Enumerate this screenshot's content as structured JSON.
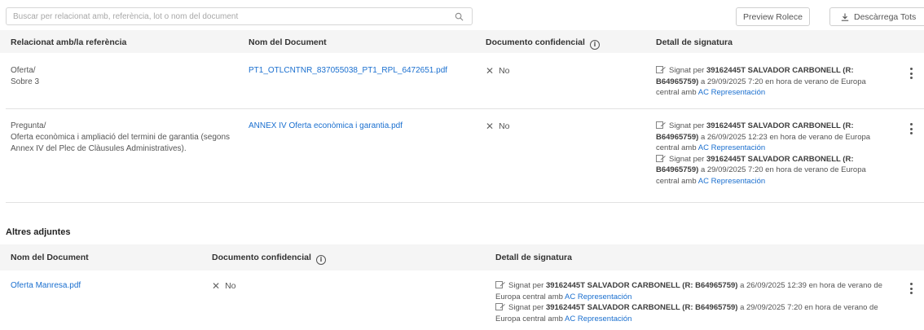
{
  "search": {
    "placeholder": "Buscar per relacionat amb, referència, lot o nom del document",
    "value": ""
  },
  "toolbar": {
    "preview_label": "Preview Rolece",
    "download_label": "Descàrrega Tots"
  },
  "table1": {
    "headers": {
      "related": "Relacionat amb/la referència",
      "doc_name": "Nom del Document",
      "confidential": "Documento confidencial",
      "signature": "Detall de signatura"
    },
    "rows": [
      {
        "related_line1": "Oferta/",
        "related_line2": "Sobre 3",
        "doc_name": "PT1_OTLCNTNR_837055038_PT1_RPL_6472651.pdf",
        "confidential": "No",
        "signatures": [
          {
            "prefix": "Signat per",
            "signer": "39162445T SALVADOR CARBONELL (R: B64965759)",
            "mid": "a 29/09/2025 7:20 en hora de verano de Europa central amb",
            "authority": "AC Representación"
          }
        ]
      },
      {
        "related_line1": "Pregunta/",
        "related_line2": "Oferta econòmica i ampliació del termini de garantia (segons Annex IV del Plec de Clàusules Administratives).",
        "doc_name": "ANNEX IV Oferta econòmica i garantia.pdf",
        "confidential": "No",
        "signatures": [
          {
            "prefix": "Signat per",
            "signer": "39162445T SALVADOR CARBONELL (R: B64965759)",
            "mid": "a 26/09/2025 12:23 en hora de verano de Europa central amb",
            "authority": "AC Representación"
          },
          {
            "prefix": "Signat per",
            "signer": "39162445T SALVADOR CARBONELL (R: B64965759)",
            "mid": "a 29/09/2025 7:20 en hora de verano de Europa central amb",
            "authority": "AC Representación"
          }
        ]
      }
    ]
  },
  "other_attachments": {
    "title": "Altres adjuntes",
    "headers": {
      "doc_name": "Nom del Document",
      "confidential": "Documento confidencial",
      "signature": "Detall de signatura"
    },
    "rows": [
      {
        "doc_name": "Oferta Manresa.pdf",
        "confidential": "No",
        "signatures": [
          {
            "prefix": "Signat per",
            "signer": "39162445T SALVADOR CARBONELL (R: B64965759)",
            "mid": "a 26/09/2025 12:39 en hora de verano de Europa central amb",
            "authority": "AC Representación"
          },
          {
            "prefix": "Signat per",
            "signer": "39162445T SALVADOR CARBONELL (R: B64965759)",
            "mid": "a 29/09/2025 7:20 en hora de verano de Europa central amb",
            "authority": "AC Representación"
          }
        ]
      }
    ]
  },
  "colors": {
    "link": "#1a6fcf",
    "header_bg": "#f5f5f5",
    "border": "#e2e2e2"
  },
  "icons": {
    "search": "search-icon",
    "download": "download-icon",
    "info": "info-icon",
    "signature": "signature-icon",
    "kebab": "kebab-menu-icon",
    "x": "x-icon"
  }
}
